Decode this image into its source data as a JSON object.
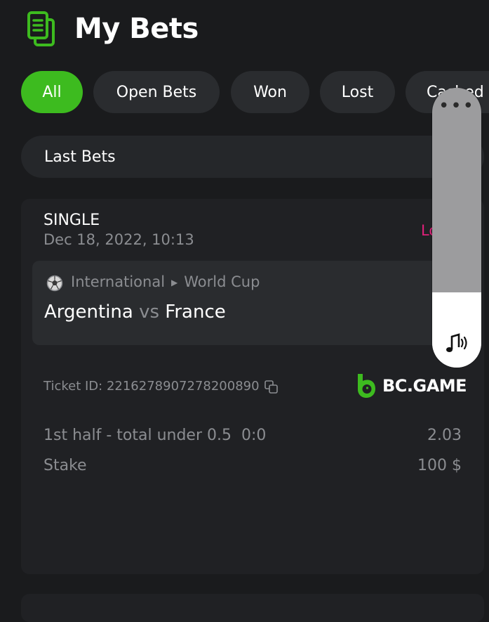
{
  "header": {
    "title": "My Bets",
    "icon": "bets-document-icon"
  },
  "filters": [
    {
      "label": "All",
      "active": true
    },
    {
      "label": "Open Bets",
      "active": false
    },
    {
      "label": "Won",
      "active": false
    },
    {
      "label": "Lost",
      "active": false
    },
    {
      "label": "Cashed",
      "active": false
    }
  ],
  "last_bets": {
    "label": "Last Bets",
    "icon": "chevron-icon"
  },
  "bet": {
    "type": "SINGLE",
    "date": "Dec 18, 2022, 10:13",
    "status": "Lost",
    "sport_icon": "soccer-ball-icon",
    "league": {
      "region": "International",
      "competition": "World Cup"
    },
    "teams": {
      "home": "Argentina",
      "vs": "vs",
      "away": "France"
    },
    "ticket_label": "Ticket ID:",
    "ticket_id": "2216278907278200890",
    "brand": "BC.GAME",
    "selection": {
      "label": "1st half - total under 0.5",
      "score": "0:0",
      "odds": "2.03"
    },
    "stake": {
      "label": "Stake",
      "value": "100 $"
    }
  },
  "volume_overlay": {
    "menu": "•••",
    "icon": "volume-music-icon",
    "level": 0.27
  },
  "colors": {
    "accent": "#3dbb1f",
    "lost": "#e0207a",
    "background": "#1a1b1d",
    "card": "#202124"
  }
}
